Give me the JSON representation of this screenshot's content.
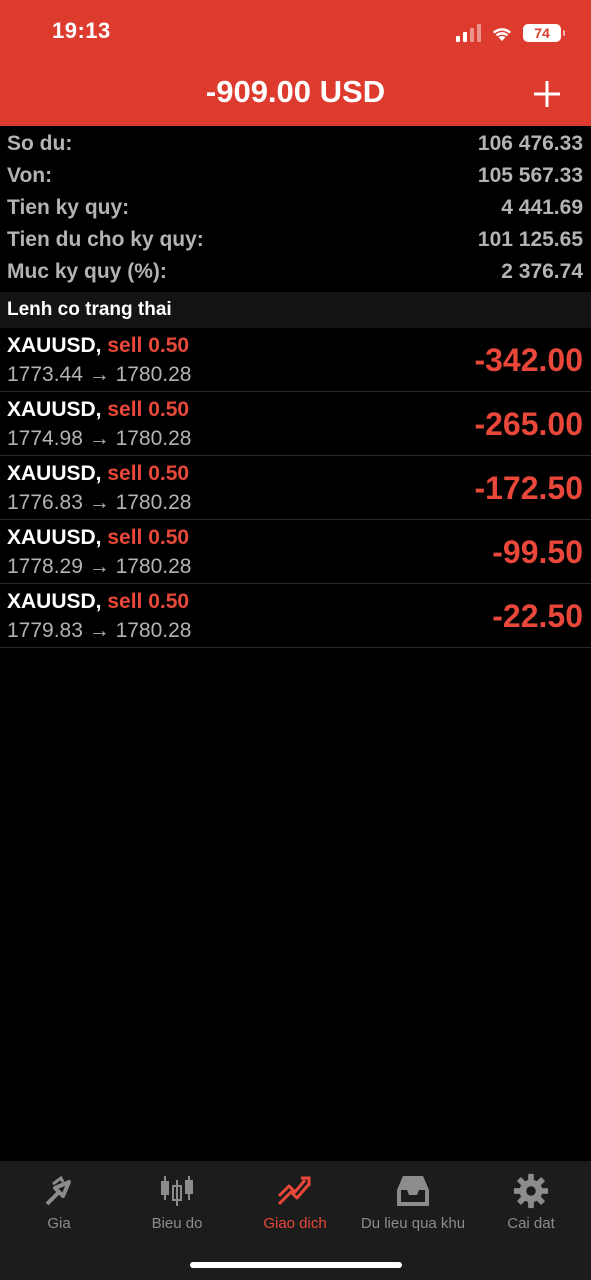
{
  "status": {
    "time": "19:13",
    "battery": "74"
  },
  "header": {
    "title": "-909.00 USD",
    "add_icon": "plus-icon"
  },
  "summary": [
    {
      "label": "So du:",
      "value": "106 476.33"
    },
    {
      "label": "Von:",
      "value": "105 567.33"
    },
    {
      "label": "Tien ky quy:",
      "value": "4 441.69"
    },
    {
      "label": "Tien du cho ky quy:",
      "value": "101 125.65"
    },
    {
      "label": "Muc ky quy (%):",
      "value": "2 376.74"
    }
  ],
  "section_title": "Lenh co trang thai",
  "positions": [
    {
      "symbol": "XAUUSD,",
      "side": "sell 0.50",
      "prices": "1773.44 → 1780.28",
      "profit": "-342.00"
    },
    {
      "symbol": "XAUUSD,",
      "side": "sell 0.50",
      "prices": "1774.98 → 1780.28",
      "profit": "-265.00"
    },
    {
      "symbol": "XAUUSD,",
      "side": "sell 0.50",
      "prices": "1776.83 → 1780.28",
      "profit": "-172.50"
    },
    {
      "symbol": "XAUUSD,",
      "side": "sell 0.50",
      "prices": "1778.29 → 1780.28",
      "profit": "-99.50"
    },
    {
      "symbol": "XAUUSD,",
      "side": "sell 0.50",
      "prices": "1779.83 → 1780.28",
      "profit": "-22.50"
    }
  ],
  "tabs": [
    {
      "label": "Gia",
      "icon": "arrows-icon"
    },
    {
      "label": "Bieu do",
      "icon": "candlestick-icon"
    },
    {
      "label": "Giao dich",
      "icon": "trade-icon",
      "active": true
    },
    {
      "label": "Du lieu qua khu",
      "icon": "inbox-icon"
    },
    {
      "label": "Cai dat",
      "icon": "gear-icon"
    }
  ],
  "colors": {
    "accent": "#dd3b2e",
    "loss": "#e8473a",
    "background": "#000000"
  }
}
